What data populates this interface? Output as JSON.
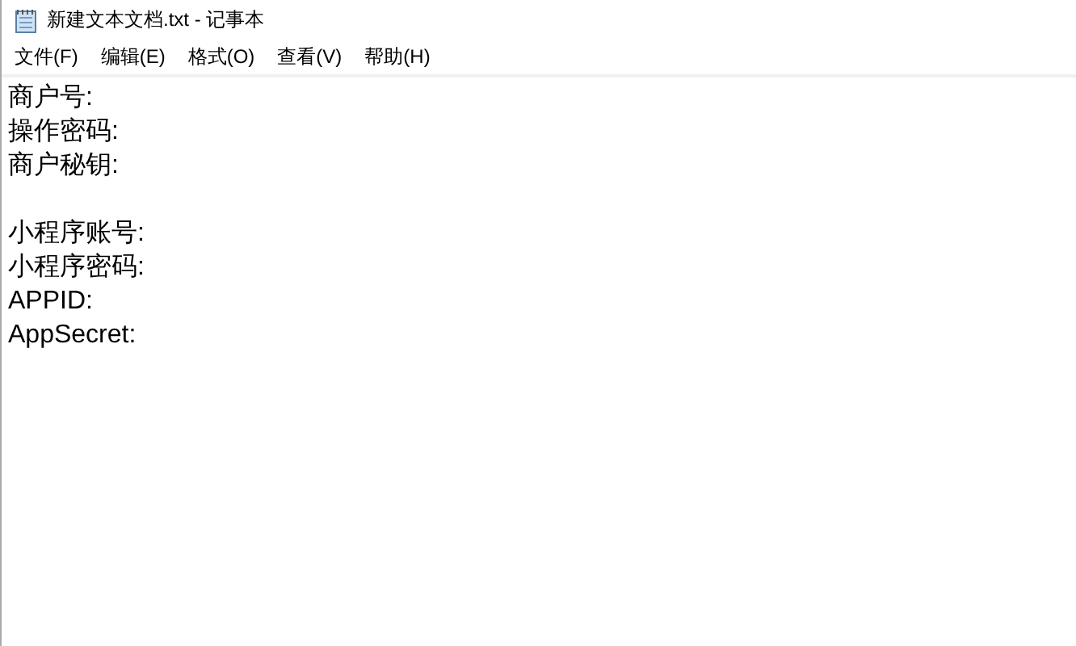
{
  "window": {
    "title": "新建文本文档.txt - 记事本"
  },
  "menu": [
    "文件(F)",
    "编辑(E)",
    "格式(O)",
    "查看(V)",
    "帮助(H)"
  ],
  "paragraphs": [
    [
      "商户号:",
      "操作密码:",
      "商户秘钥:"
    ],
    [
      "小程序账号:",
      "小程序密码:",
      "APPID:",
      "AppSecret:"
    ]
  ]
}
